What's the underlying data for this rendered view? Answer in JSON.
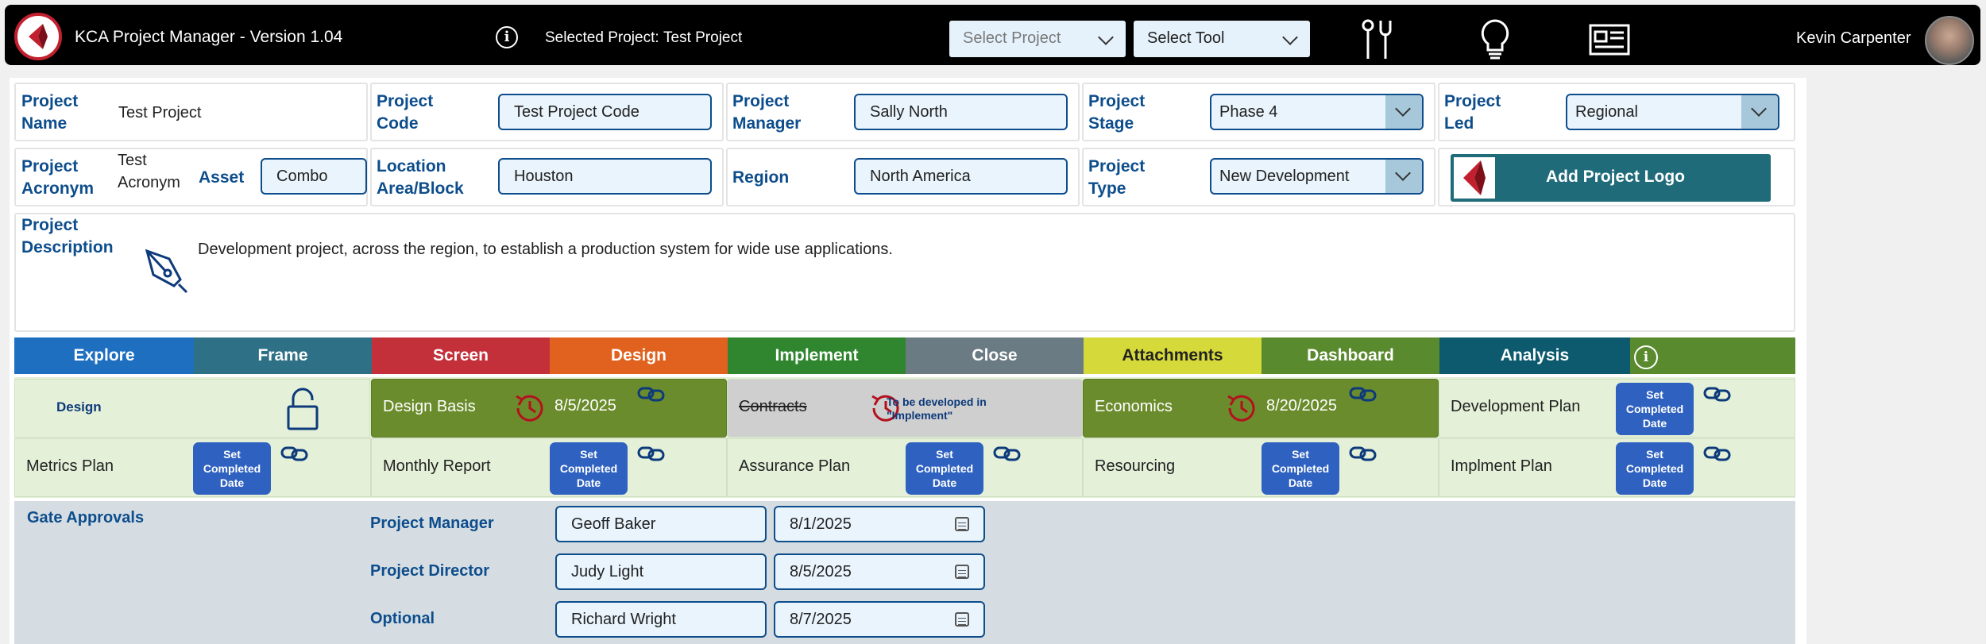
{
  "header": {
    "app_title": "KCA Project Manager - Version 1.04",
    "selected_project_label": "Selected Project:",
    "selected_project_value": "Test Project",
    "select_project_placeholder": "Select Project",
    "select_tool_value": "Select Tool",
    "user_name": "Kevin Carpenter"
  },
  "fields": {
    "project_name_label": "Project Name",
    "project_name_value": "Test Project",
    "project_code_label": "Project Code",
    "project_code_value": "Test Project Code",
    "project_manager_label": "Project Manager",
    "project_manager_value": "Sally North",
    "project_stage_label": "Project Stage",
    "project_stage_value": "Phase 4",
    "project_led_label": "Project Led",
    "project_led_value": "Regional",
    "project_acronym_label": "Project Acronym",
    "project_acronym_value": "Test Acronym",
    "asset_label": "Asset",
    "asset_value": "Combo",
    "location_label": "Location Area/Block",
    "location_value": "Houston",
    "region_label": "Region",
    "region_value": "North America",
    "project_type_label": "Project Type",
    "project_type_value": "New Development",
    "add_logo_label": "Add Project Logo",
    "description_label": "Project Description",
    "description_value": "Development project, across the region, to establish a production system for wide use applications."
  },
  "tabs": [
    {
      "label": "Explore",
      "color": "#1e6fc0"
    },
    {
      "label": "Frame",
      "color": "#2e7186"
    },
    {
      "label": "Screen",
      "color": "#c3303a"
    },
    {
      "label": "Design",
      "color": "#e0621e"
    },
    {
      "label": "Implement",
      "color": "#2f862f"
    },
    {
      "label": "Close",
      "color": "#6b7b83"
    },
    {
      "label": "Attachments",
      "color": "#d6d93a"
    },
    {
      "label": "Dashboard",
      "color": "#5a8a2e"
    },
    {
      "label": "Analysis",
      "color": "#0d5a6e"
    },
    {
      "label": "",
      "color": "#5a8a2e"
    }
  ],
  "deliverables": {
    "row1_title": "Design",
    "design_basis": {
      "name": "Design Basis",
      "date": "8/5/2025"
    },
    "contracts": {
      "name": "Contracts",
      "note_line1": "To be developed in",
      "note_line2": "\"Implement\""
    },
    "economics": {
      "name": "Economics",
      "date": "8/20/2025"
    },
    "development_plan": {
      "name": "Development Plan"
    },
    "metrics_plan": {
      "name": "Metrics Plan"
    },
    "monthly_report": {
      "name": "Monthly Report"
    },
    "assurance_plan": {
      "name": "Assurance Plan"
    },
    "resourcing": {
      "name": "Resourcing"
    },
    "implement_plan": {
      "name": "Implment Plan"
    },
    "set_btn_line1": "Set",
    "set_btn_line2": "Completed",
    "set_btn_line3": "Date"
  },
  "gate": {
    "title": "Gate Approvals",
    "rows": [
      {
        "role": "Project Manager",
        "name": "Geoff Baker",
        "date": "8/1/2025"
      },
      {
        "role": "Project Director",
        "name": "Judy Light",
        "date": "8/5/2025"
      },
      {
        "role": "Optional",
        "name": "Richard Wright",
        "date": "8/7/2025"
      }
    ]
  },
  "colors": {
    "brand_red": "#c3202f",
    "label_blue": "#0d4d8c",
    "completed_green": "#6b8c2c",
    "set_button_blue": "#2f62c0"
  },
  "icons": [
    "brand-logo-icon",
    "info-icon",
    "tools-icon",
    "lightbulb-icon",
    "newspaper-icon",
    "pen-icon",
    "unlock-icon",
    "history-icon",
    "link-icon",
    "calendar-icon"
  ]
}
